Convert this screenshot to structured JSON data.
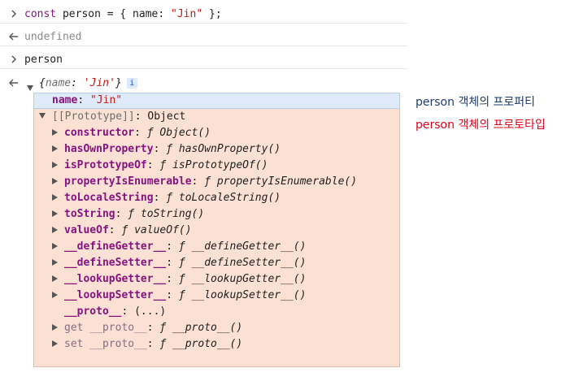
{
  "console": {
    "input1": {
      "prompt_icon": "chevron-right-icon",
      "kw_const": "const",
      "code_mid": " person = { name: ",
      "code_str": "\"Jin\"",
      "code_end": " };"
    },
    "output1": {
      "prompt_icon": "return-arrow-icon",
      "text": "undefined"
    },
    "input2": {
      "prompt_icon": "chevron-right-icon",
      "text": "person"
    },
    "output2": {
      "prompt_icon": "return-arrow-icon",
      "preview_open": "{",
      "preview_key": "name",
      "preview_colon": ": ",
      "preview_val": "'Jin'",
      "preview_close": "}",
      "info_badge": "i"
    }
  },
  "tree": {
    "own_prop": {
      "key": "name",
      "colon": ": ",
      "value": "\"Jin\""
    },
    "prototype": {
      "label": "[[Prototype]]",
      "colon": ": ",
      "value": "Object"
    },
    "members": [
      {
        "key": "constructor",
        "f": "ƒ",
        "fn": "Object()"
      },
      {
        "key": "hasOwnProperty",
        "f": "ƒ",
        "fn": "hasOwnProperty()"
      },
      {
        "key": "isPrototypeOf",
        "f": "ƒ",
        "fn": "isPrototypeOf()"
      },
      {
        "key": "propertyIsEnumerable",
        "f": "ƒ",
        "fn": "propertyIsEnumerable()"
      },
      {
        "key": "toLocaleString",
        "f": "ƒ",
        "fn": "toLocaleString()"
      },
      {
        "key": "toString",
        "f": "ƒ",
        "fn": "toString()"
      },
      {
        "key": "valueOf",
        "f": "ƒ",
        "fn": "valueOf()"
      },
      {
        "key": "__defineGetter__",
        "f": "ƒ",
        "fn": "__defineGetter__()"
      },
      {
        "key": "__defineSetter__",
        "f": "ƒ",
        "fn": "__defineSetter__()"
      },
      {
        "key": "__lookupGetter__",
        "f": "ƒ",
        "fn": "__lookupGetter__()"
      },
      {
        "key": "__lookupSetter__",
        "f": "ƒ",
        "fn": "__lookupSetter__()"
      }
    ],
    "proto_accessor": {
      "key": "__proto__",
      "value": "(...)"
    },
    "get_proto": {
      "prefix": "get ",
      "key": "__proto__",
      "f": "ƒ",
      "fn": "__proto__()"
    },
    "set_proto": {
      "prefix": "set ",
      "key": "__proto__",
      "f": "ƒ",
      "fn": "__proto__()"
    }
  },
  "annotations": {
    "own": {
      "text": "person 객체의 프로퍼티",
      "color": "#1e3a6e"
    },
    "proto": {
      "text": "person 객체의 프로토타입",
      "color": "#e0001b"
    }
  }
}
